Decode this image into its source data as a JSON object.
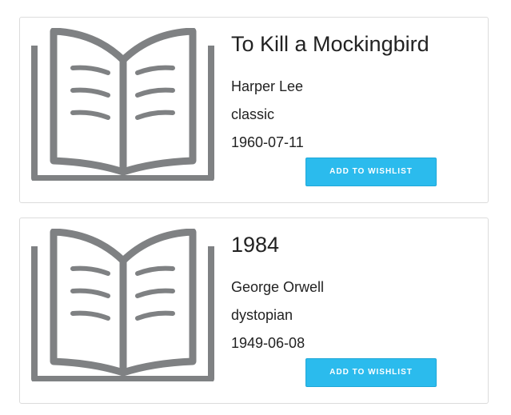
{
  "books": [
    {
      "cover_icon": "open-book-icon",
      "title": "To Kill a Mockingbird",
      "author": "Harper Lee",
      "genre": "classic",
      "date": "1960-07-11",
      "button_label": "ADD TO WISHLIST"
    },
    {
      "cover_icon": "open-book-icon",
      "title": "1984",
      "author": "George Orwell",
      "genre": "dystopian",
      "date": "1949-06-08",
      "button_label": "ADD TO WISHLIST"
    }
  ],
  "colors": {
    "icon": "#7f8183",
    "button": "#2bbbed",
    "button_text": "#ffffff",
    "card_border": "#dcdcdc"
  }
}
